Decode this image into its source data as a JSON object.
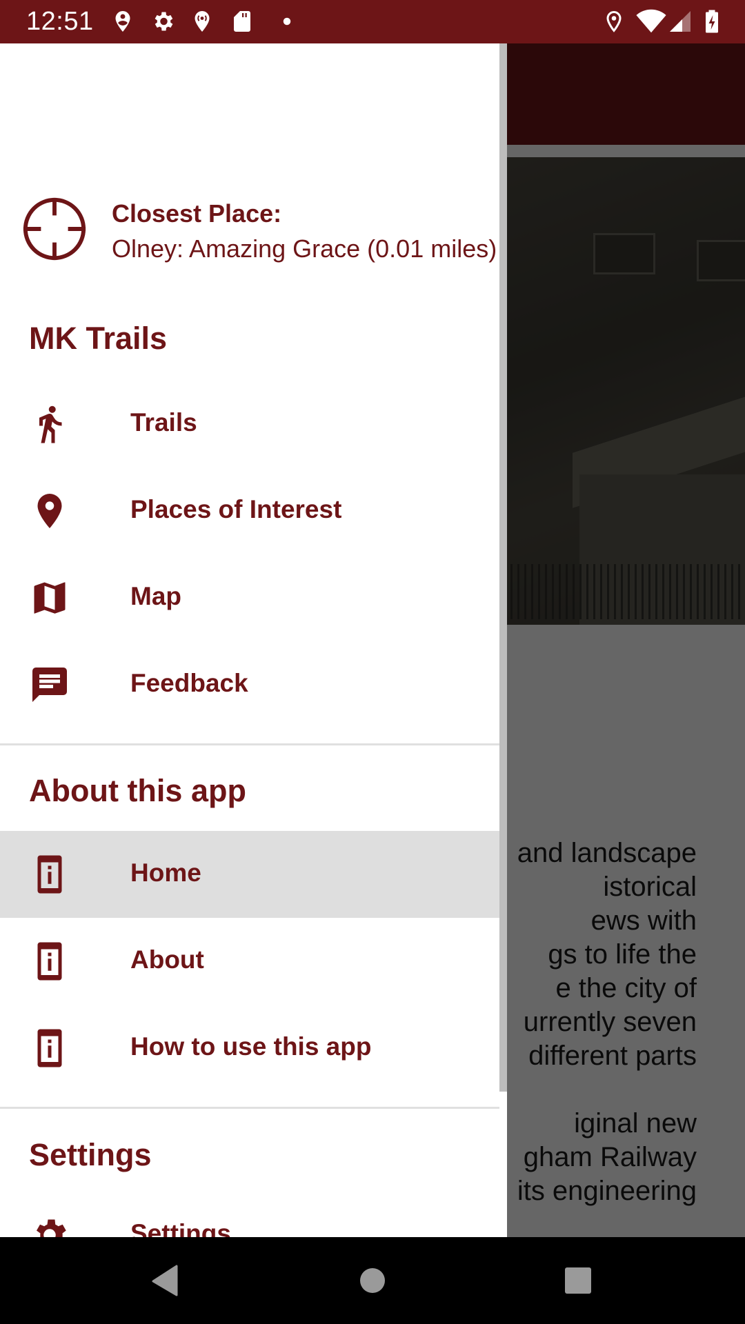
{
  "status_bar": {
    "time": "12:51",
    "left_icons": [
      "location-person-icon",
      "settings-icon",
      "location-broadcast-icon",
      "sd-card-icon",
      "dot-icon"
    ],
    "right_icons": [
      "location-icon",
      "wifi-icon",
      "signal-icon",
      "battery-charging-icon"
    ]
  },
  "drawer": {
    "closest_place": {
      "icon": "crosshair-icon",
      "title": "Closest Place:",
      "value": "Olney: Amazing Grace (0.01 miles)"
    },
    "sections": [
      {
        "header": "MK Trails",
        "items": [
          {
            "label": "Trails",
            "icon": "walk-icon",
            "selected": false
          },
          {
            "label": "Places of Interest",
            "icon": "place-icon",
            "selected": false
          },
          {
            "label": "Map",
            "icon": "map-icon",
            "selected": false
          },
          {
            "label": "Feedback",
            "icon": "feedback-icon",
            "selected": false
          }
        ]
      },
      {
        "header": "About this app",
        "items": [
          {
            "label": "Home",
            "icon": "info-icon",
            "selected": true
          },
          {
            "label": "About",
            "icon": "info-icon",
            "selected": false
          },
          {
            "label": "How to use this app",
            "icon": "info-icon",
            "selected": false
          }
        ]
      },
      {
        "header": "Settings",
        "items": [
          {
            "label": "Settings",
            "icon": "settings-icon",
            "selected": false
          }
        ]
      }
    ]
  },
  "background_content": {
    "paragraph_1_lines": [
      "and landscape",
      "istorical",
      "ews with",
      "gs to life the",
      "e the city of",
      "urrently seven",
      "different parts"
    ],
    "paragraph_2_lines": [
      "iginal new",
      "gham Railway",
      "its engineering"
    ]
  },
  "colors": {
    "brand": "#6d1517",
    "selected_bg": "#dedede"
  },
  "nav_bar": {
    "back": "back-icon",
    "home": "home-icon",
    "recents": "recents-icon"
  }
}
